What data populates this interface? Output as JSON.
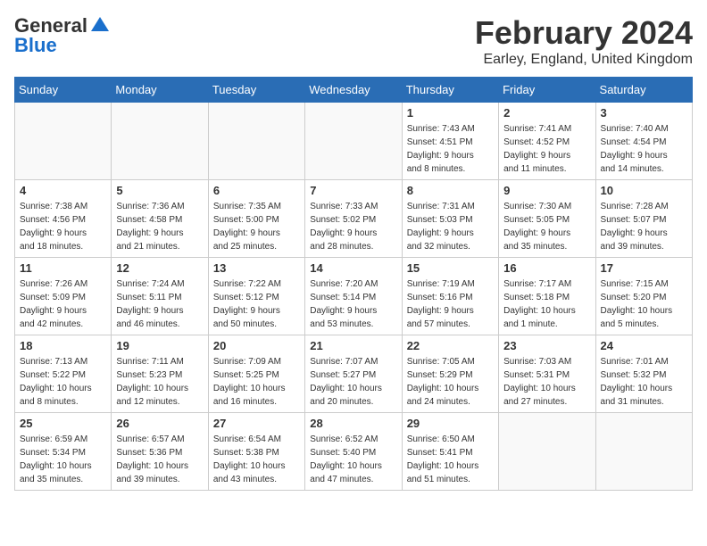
{
  "logo": {
    "general": "General",
    "blue": "Blue"
  },
  "title": "February 2024",
  "location": "Earley, England, United Kingdom",
  "days_of_week": [
    "Sunday",
    "Monday",
    "Tuesday",
    "Wednesday",
    "Thursday",
    "Friday",
    "Saturday"
  ],
  "weeks": [
    [
      {
        "day": "",
        "info": ""
      },
      {
        "day": "",
        "info": ""
      },
      {
        "day": "",
        "info": ""
      },
      {
        "day": "",
        "info": ""
      },
      {
        "day": "1",
        "info": "Sunrise: 7:43 AM\nSunset: 4:51 PM\nDaylight: 9 hours\nand 8 minutes."
      },
      {
        "day": "2",
        "info": "Sunrise: 7:41 AM\nSunset: 4:52 PM\nDaylight: 9 hours\nand 11 minutes."
      },
      {
        "day": "3",
        "info": "Sunrise: 7:40 AM\nSunset: 4:54 PM\nDaylight: 9 hours\nand 14 minutes."
      }
    ],
    [
      {
        "day": "4",
        "info": "Sunrise: 7:38 AM\nSunset: 4:56 PM\nDaylight: 9 hours\nand 18 minutes."
      },
      {
        "day": "5",
        "info": "Sunrise: 7:36 AM\nSunset: 4:58 PM\nDaylight: 9 hours\nand 21 minutes."
      },
      {
        "day": "6",
        "info": "Sunrise: 7:35 AM\nSunset: 5:00 PM\nDaylight: 9 hours\nand 25 minutes."
      },
      {
        "day": "7",
        "info": "Sunrise: 7:33 AM\nSunset: 5:02 PM\nDaylight: 9 hours\nand 28 minutes."
      },
      {
        "day": "8",
        "info": "Sunrise: 7:31 AM\nSunset: 5:03 PM\nDaylight: 9 hours\nand 32 minutes."
      },
      {
        "day": "9",
        "info": "Sunrise: 7:30 AM\nSunset: 5:05 PM\nDaylight: 9 hours\nand 35 minutes."
      },
      {
        "day": "10",
        "info": "Sunrise: 7:28 AM\nSunset: 5:07 PM\nDaylight: 9 hours\nand 39 minutes."
      }
    ],
    [
      {
        "day": "11",
        "info": "Sunrise: 7:26 AM\nSunset: 5:09 PM\nDaylight: 9 hours\nand 42 minutes."
      },
      {
        "day": "12",
        "info": "Sunrise: 7:24 AM\nSunset: 5:11 PM\nDaylight: 9 hours\nand 46 minutes."
      },
      {
        "day": "13",
        "info": "Sunrise: 7:22 AM\nSunset: 5:12 PM\nDaylight: 9 hours\nand 50 minutes."
      },
      {
        "day": "14",
        "info": "Sunrise: 7:20 AM\nSunset: 5:14 PM\nDaylight: 9 hours\nand 53 minutes."
      },
      {
        "day": "15",
        "info": "Sunrise: 7:19 AM\nSunset: 5:16 PM\nDaylight: 9 hours\nand 57 minutes."
      },
      {
        "day": "16",
        "info": "Sunrise: 7:17 AM\nSunset: 5:18 PM\nDaylight: 10 hours\nand 1 minute."
      },
      {
        "day": "17",
        "info": "Sunrise: 7:15 AM\nSunset: 5:20 PM\nDaylight: 10 hours\nand 5 minutes."
      }
    ],
    [
      {
        "day": "18",
        "info": "Sunrise: 7:13 AM\nSunset: 5:22 PM\nDaylight: 10 hours\nand 8 minutes."
      },
      {
        "day": "19",
        "info": "Sunrise: 7:11 AM\nSunset: 5:23 PM\nDaylight: 10 hours\nand 12 minutes."
      },
      {
        "day": "20",
        "info": "Sunrise: 7:09 AM\nSunset: 5:25 PM\nDaylight: 10 hours\nand 16 minutes."
      },
      {
        "day": "21",
        "info": "Sunrise: 7:07 AM\nSunset: 5:27 PM\nDaylight: 10 hours\nand 20 minutes."
      },
      {
        "day": "22",
        "info": "Sunrise: 7:05 AM\nSunset: 5:29 PM\nDaylight: 10 hours\nand 24 minutes."
      },
      {
        "day": "23",
        "info": "Sunrise: 7:03 AM\nSunset: 5:31 PM\nDaylight: 10 hours\nand 27 minutes."
      },
      {
        "day": "24",
        "info": "Sunrise: 7:01 AM\nSunset: 5:32 PM\nDaylight: 10 hours\nand 31 minutes."
      }
    ],
    [
      {
        "day": "25",
        "info": "Sunrise: 6:59 AM\nSunset: 5:34 PM\nDaylight: 10 hours\nand 35 minutes."
      },
      {
        "day": "26",
        "info": "Sunrise: 6:57 AM\nSunset: 5:36 PM\nDaylight: 10 hours\nand 39 minutes."
      },
      {
        "day": "27",
        "info": "Sunrise: 6:54 AM\nSunset: 5:38 PM\nDaylight: 10 hours\nand 43 minutes."
      },
      {
        "day": "28",
        "info": "Sunrise: 6:52 AM\nSunset: 5:40 PM\nDaylight: 10 hours\nand 47 minutes."
      },
      {
        "day": "29",
        "info": "Sunrise: 6:50 AM\nSunset: 5:41 PM\nDaylight: 10 hours\nand 51 minutes."
      },
      {
        "day": "",
        "info": ""
      },
      {
        "day": "",
        "info": ""
      }
    ]
  ]
}
